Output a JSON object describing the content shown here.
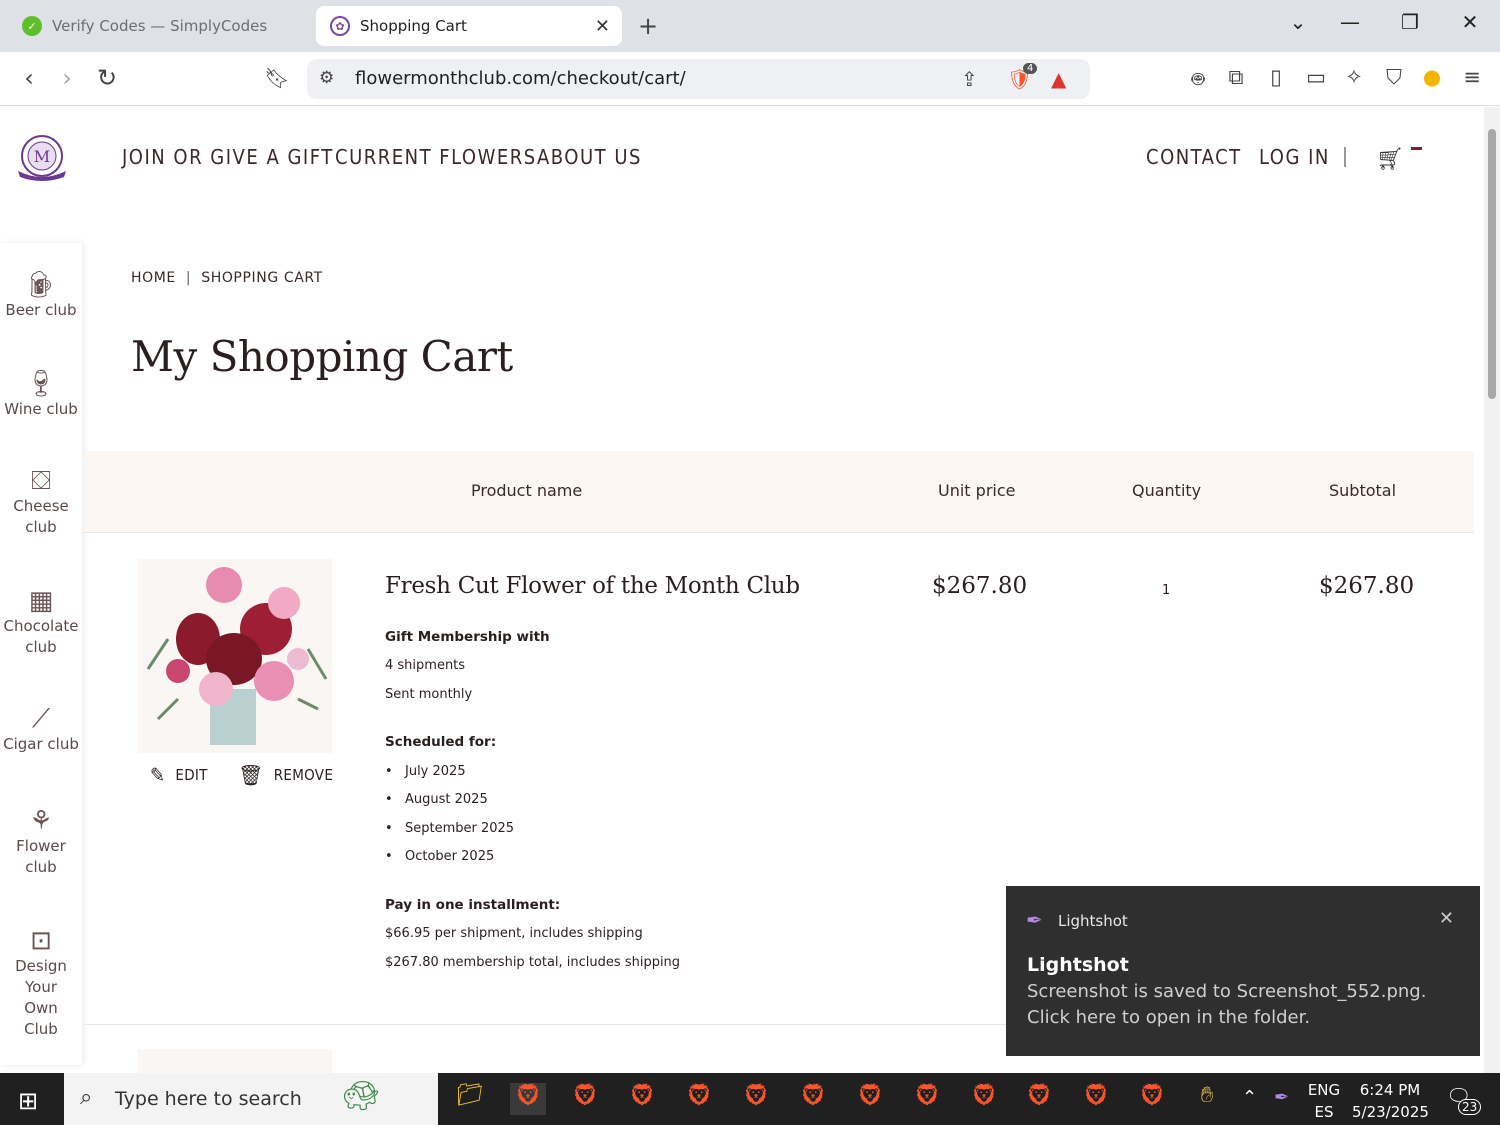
{
  "browser": {
    "tabs": [
      {
        "title": "Verify Codes — SimplyCodes",
        "active": false
      },
      {
        "title": "Shopping Cart",
        "active": true
      }
    ],
    "url": "flowermonthclub.com/checkout/cart/",
    "brave_badge": "4"
  },
  "header": {
    "nav_left": [
      "JOIN OR GIVE A GIFT",
      "CURRENT FLOWERS",
      "ABOUT US"
    ],
    "nav_right": [
      "CONTACT",
      "LOG IN"
    ]
  },
  "sidebar": {
    "items": [
      {
        "label": "Beer club",
        "icon": "beer-mug-icon"
      },
      {
        "label": "Wine club",
        "icon": "wine-glass-icon"
      },
      {
        "label": "Cheese club",
        "icon": "cheese-icon"
      },
      {
        "label": "Chocolate club",
        "icon": "chocolate-icon"
      },
      {
        "label": "Cigar club",
        "icon": "cigar-icon"
      },
      {
        "label": "Flower club",
        "icon": "flower-icon"
      },
      {
        "label": "Design Your Own Club",
        "icon": "design-icon"
      }
    ]
  },
  "breadcrumb": {
    "home": "HOME",
    "current": "SHOPPING CART"
  },
  "page_title": "My Shopping Cart",
  "table": {
    "headers": [
      "Product name",
      "Unit price",
      "Quantity",
      "Subtotal"
    ]
  },
  "cart_item": {
    "name": "Fresh Cut Flower of the Month Club",
    "unit_price": "$267.80",
    "quantity": "1",
    "subtotal": "$267.80",
    "edit_label": "EDIT",
    "remove_label": "REMOVE",
    "membership_heading": "Gift Membership with",
    "shipments": "4 shipments",
    "frequency": "Sent monthly",
    "scheduled_heading": "Scheduled for:",
    "scheduled": [
      "July 2025",
      "August 2025",
      "September 2025",
      "October 2025"
    ],
    "pay_heading": "Pay in one installment:",
    "per_shipment": "$66.95 per shipment, includes shipping",
    "membership_total": "$267.80 membership total, includes shipping"
  },
  "toast": {
    "app": "Lightshot",
    "title": "Lightshot",
    "message": "Screenshot is saved to Screenshot_552.png. Click here to open in the folder."
  },
  "taskbar": {
    "search_placeholder": "Type here to search",
    "lang_top": "ENG",
    "lang_bottom": "ES",
    "time": "6:24 PM",
    "date": "5/23/2025",
    "notifications": "23"
  }
}
